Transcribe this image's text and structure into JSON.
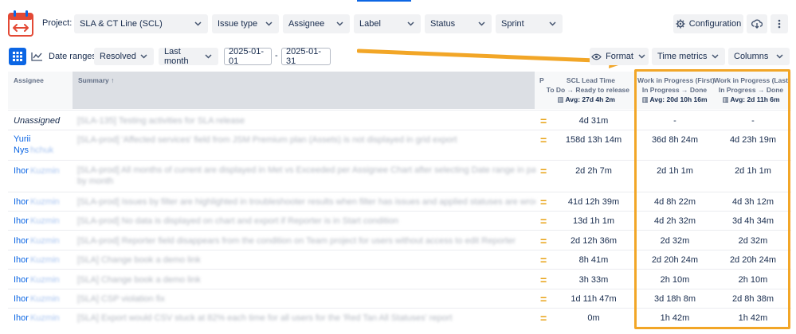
{
  "toolbar": {
    "project_label": "Project:",
    "project_value": "SLA & CT Line (SCL)",
    "filters": [
      "Issue type",
      "Assignee",
      "Label",
      "Status",
      "Sprint"
    ],
    "configuration_label": "Configuration"
  },
  "toolbar2": {
    "date_ranges_label": "Date ranges:",
    "date_field": "Resolved",
    "period": "Last month",
    "date_from": "2025-01-01",
    "date_sep": "-",
    "date_to": "2025-01-31",
    "format_label": "Format",
    "time_metrics_label": "Time metrics",
    "columns_label": "Columns"
  },
  "table": {
    "headers": {
      "assignee": "Assignee",
      "summary": "Summary ↑",
      "priority": "P",
      "col1": {
        "title": "SCL Lead Time",
        "transition": "To Do → Ready to release",
        "avg": "Avg: 27d 4h 2m"
      },
      "col2": {
        "title": "Work in Progress (First)",
        "transition": "In Progress → Done",
        "avg": "Avg: 20d 10h 16m"
      },
      "col3": {
        "title": "Work in Progress (Last)",
        "transition": "In Progress → Done",
        "avg": "Avg: 2d 11h 6m"
      }
    },
    "rows": [
      {
        "assignee": "Unassigned",
        "assignee_blur": "",
        "summary": "[SLA-135] Testing activities for SLA release",
        "priority": "=",
        "v1": "4d 31m",
        "v2": "-",
        "v3": "-"
      },
      {
        "assignee": "Yurii",
        "assignee2": "Nys",
        "assignee_blur": "hchuk",
        "summary": "[SLA-prod] 'Affected services' field from JSM Premium plan (Assets) is not displayed in grid export",
        "priority": "=",
        "v1": "158d 13h 14m",
        "v2": "36d 8h 24m",
        "v3": "4d 23h 19m"
      },
      {
        "assignee": "Ihor",
        "assignee_blur": "Kuzmin",
        "summary": "[SLA-prod] All months of current are displayed in Met vs Exceeded per Assignee Chart after selecting Date range in past and group",
        "summary2": "by month",
        "priority": "=",
        "v1": "2d 2h 7m",
        "v2": "2d 1h 1m",
        "v3": "2d 1h 1m"
      },
      {
        "assignee": "Ihor",
        "assignee_blur": "Kuzmin",
        "summary": "[SLA-prod] Issues by filter are highlighted in troubleshooter results when filter has issues and applied statuses are wrong",
        "priority": "=",
        "v1": "41d 12h 39m",
        "v2": "4d 8h 22m",
        "v3": "4d 3h 12m"
      },
      {
        "assignee": "Ihor",
        "assignee_blur": "Kuzmin",
        "summary": "[SLA-prod] No data is displayed on chart and export if Reporter is in Start condition",
        "priority": "=",
        "v1": "13d 1h 1m",
        "v2": "4d 2h 32m",
        "v3": "3d 4h 34m"
      },
      {
        "assignee": "Ihor",
        "assignee_blur": "Kuzmin",
        "summary": "[SLA-prod] Reporter field disappears from the condition on Team project for users without access to edit Reporter",
        "priority": "=",
        "v1": "2d 12h 36m",
        "v2": "2d 32m",
        "v3": "2d 32m"
      },
      {
        "assignee": "Ihor",
        "assignee_blur": "Kuzmin",
        "summary": "[SLA] Change book a demo link",
        "priority": "=",
        "v1": "8h 41m",
        "v2": "2d 20h 24m",
        "v3": "2d 20h 24m"
      },
      {
        "assignee": "Ihor",
        "assignee_blur": "Kuzmin",
        "summary": "[SLA] Change book a demo link",
        "priority": "=",
        "v1": "3h 33m",
        "v2": "2h 10m",
        "v3": "2h 10m"
      },
      {
        "assignee": "Ihor",
        "assignee_blur": "Kuzmin",
        "summary": "[SLA] CSP violation fix",
        "priority": "=",
        "v1": "1d 11h 47m",
        "v2": "3d 18h 8m",
        "v3": "2d 8h 38m"
      },
      {
        "assignee": "Ihor",
        "assignee_blur": "Kuzmin",
        "summary": "[SLA] Export would CSV stuck at 82% each time for all users for the 'Red Tan All Statuses' report",
        "priority": "=",
        "v1": "0m",
        "v2": "1h 42m",
        "v3": "1h 42m"
      }
    ]
  },
  "colors": {
    "accent": "#0c66e4",
    "highlight": "#f2a627",
    "priority": "#e8a317"
  }
}
